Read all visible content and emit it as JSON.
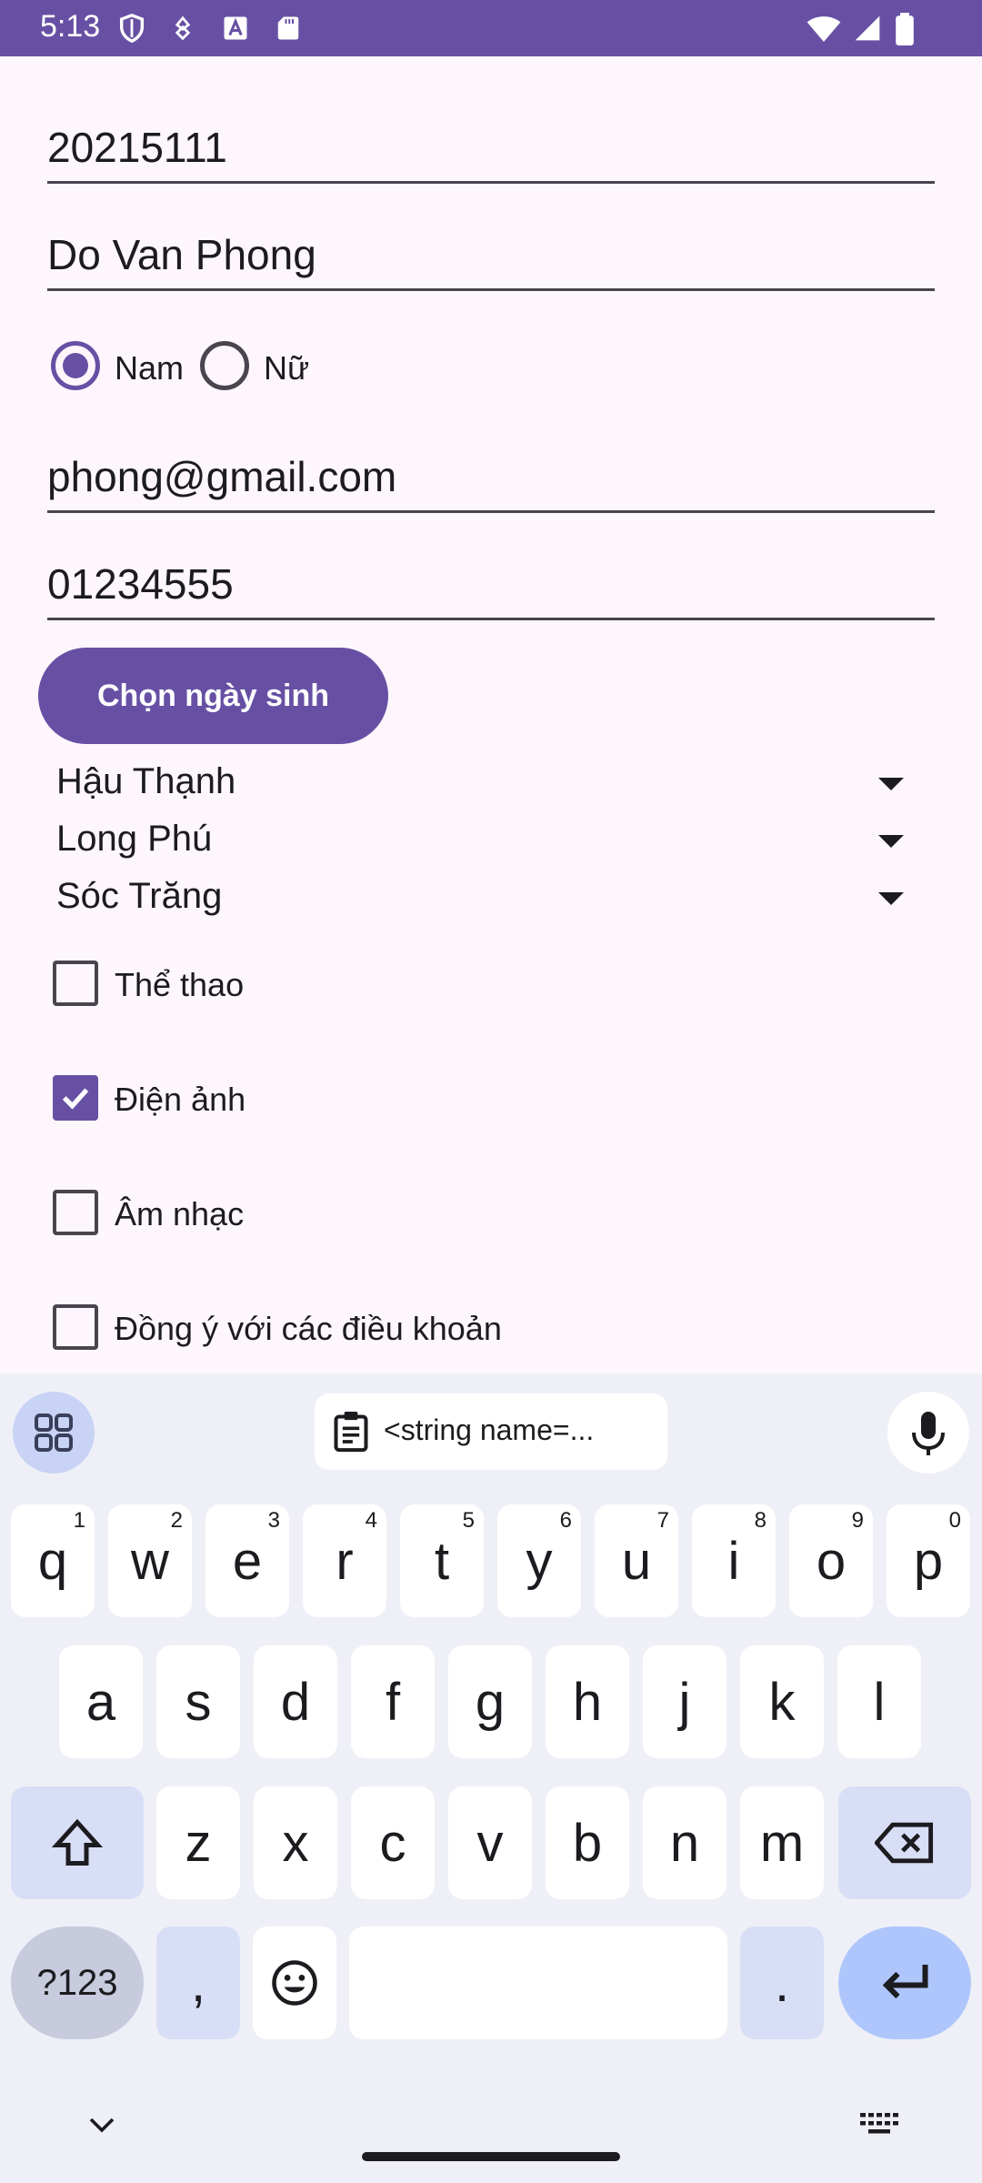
{
  "status_bar": {
    "time": "5:13"
  },
  "form": {
    "student_id": "20215111",
    "full_name": "Do Van Phong",
    "gender_options": [
      "Nam",
      "Nữ"
    ],
    "gender_selected": "Nam",
    "email": "phong@gmail.com",
    "phone": "01234555",
    "dob_button": "Chọn ngày sinh",
    "spinners": [
      "Hậu Thạnh",
      "Long Phú",
      "Sóc Trăng"
    ],
    "hobbies": [
      {
        "label": "Thể thao",
        "checked": false
      },
      {
        "label": "Điện ảnh",
        "checked": true
      },
      {
        "label": "Âm nhạc",
        "checked": false
      }
    ],
    "agree_label": "Đồng ý với các điều khoản",
    "agree_checked": false
  },
  "keyboard": {
    "clipboard_suggestion": "<string name=...",
    "row1": [
      {
        "k": "q",
        "n": "1"
      },
      {
        "k": "w",
        "n": "2"
      },
      {
        "k": "e",
        "n": "3"
      },
      {
        "k": "r",
        "n": "4"
      },
      {
        "k": "t",
        "n": "5"
      },
      {
        "k": "y",
        "n": "6"
      },
      {
        "k": "u",
        "n": "7"
      },
      {
        "k": "i",
        "n": "8"
      },
      {
        "k": "o",
        "n": "9"
      },
      {
        "k": "p",
        "n": "0"
      }
    ],
    "row2": [
      "a",
      "s",
      "d",
      "f",
      "g",
      "h",
      "j",
      "k",
      "l"
    ],
    "row3": [
      "z",
      "x",
      "c",
      "v",
      "b",
      "n",
      "m"
    ],
    "symbols_key": "?123",
    "comma_key": ",",
    "period_key": "."
  },
  "colors": {
    "primary": "#6750a4",
    "background": "#fdf7fd",
    "keyboard_bg": "#eff0f7"
  }
}
